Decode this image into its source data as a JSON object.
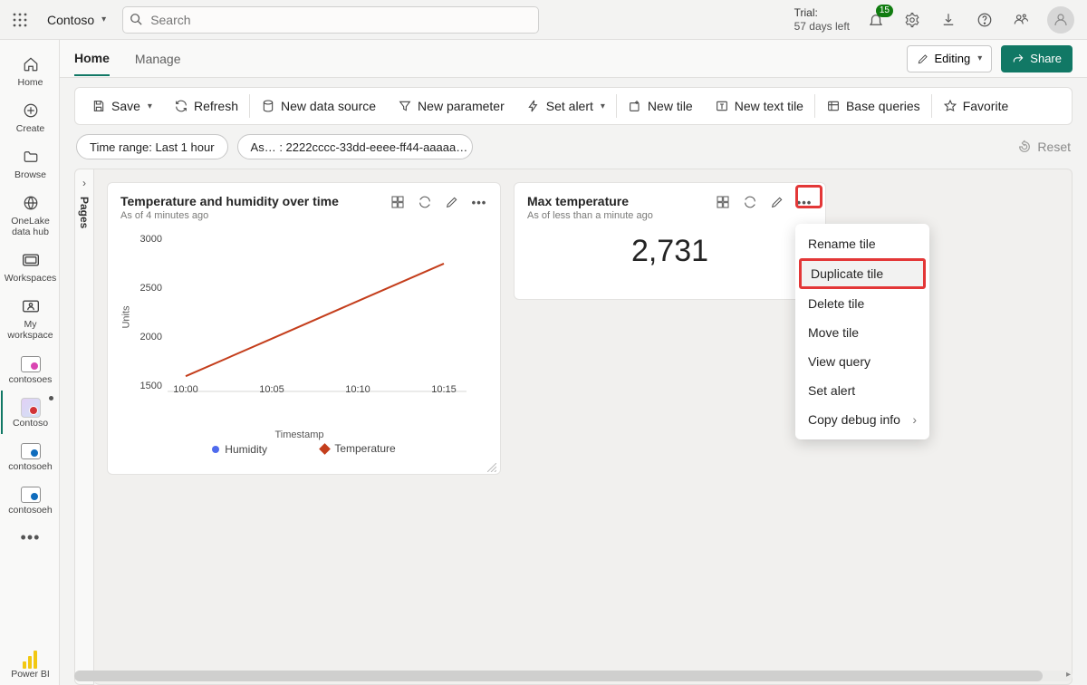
{
  "header": {
    "workspace": "Contoso",
    "search_placeholder": "Search",
    "trial_line1": "Trial:",
    "trial_line2": "57 days left",
    "notif_count": "15"
  },
  "rail": {
    "items": [
      {
        "label": "Home"
      },
      {
        "label": "Create"
      },
      {
        "label": "Browse"
      },
      {
        "label": "OneLake data hub"
      },
      {
        "label": "Workspaces"
      },
      {
        "label": "My workspace"
      },
      {
        "label": "contosoes"
      },
      {
        "label": "Contoso"
      },
      {
        "label": "contosoeh"
      },
      {
        "label": "contosoeh"
      }
    ],
    "power_bi": "Power BI"
  },
  "tabs": {
    "home": "Home",
    "manage": "Manage"
  },
  "editing": "Editing",
  "share": "Share",
  "toolbar": {
    "save": "Save",
    "refresh": "Refresh",
    "new_data_source": "New data source",
    "new_parameter": "New parameter",
    "set_alert": "Set alert",
    "new_tile": "New tile",
    "new_text_tile": "New text tile",
    "base_queries": "Base queries",
    "favorite": "Favorite"
  },
  "chips": {
    "time_range": "Time range: Last 1 hour",
    "as": "As… : 2222cccc-33dd-eeee-ff44-aaaaa…",
    "reset": "Reset"
  },
  "pages_label": "Pages",
  "chart_data": {
    "type": "line",
    "title": "Temperature and humidity over time",
    "subtitle": "As of 4 minutes ago",
    "xlabel": "Timestamp",
    "ylabel": "Units",
    "ylim": [
      1500,
      3000
    ],
    "yticks": [
      1500,
      2000,
      2500,
      3000
    ],
    "x": [
      "10:00",
      "10:05",
      "10:10",
      "10:15"
    ],
    "series": [
      {
        "name": "Humidity",
        "color": "#4f6bed",
        "values": [
          1650,
          2020,
          2390,
          2760
        ]
      },
      {
        "name": "Temperature",
        "color": "#c43e1c",
        "values": [
          1650,
          2020,
          2390,
          2760
        ]
      }
    ]
  },
  "tile2": {
    "title": "Max temperature",
    "subtitle": "As of less than a minute ago",
    "value": "2,731"
  },
  "ctx": {
    "rename": "Rename tile",
    "duplicate": "Duplicate tile",
    "delete": "Delete tile",
    "move": "Move tile",
    "view_query": "View query",
    "set_alert": "Set alert",
    "copy_debug": "Copy debug info"
  }
}
